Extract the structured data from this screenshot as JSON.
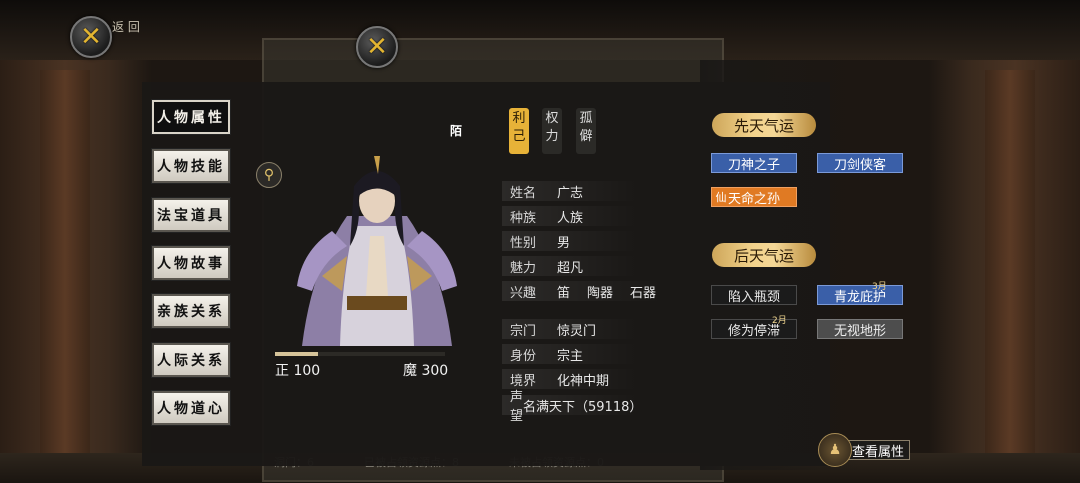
{
  "header": {
    "back_label": "返 回"
  },
  "nav": [
    {
      "label": "人物属性"
    },
    {
      "label": "人物技能"
    },
    {
      "label": "法宝道具"
    },
    {
      "label": "人物故事"
    },
    {
      "label": "亲族关系"
    },
    {
      "label": "人际关系"
    },
    {
      "label": "人物道心"
    }
  ],
  "tabs": [
    {
      "label": "利\n己"
    },
    {
      "label": "权\n力"
    },
    {
      "label": "孤\n僻"
    }
  ],
  "mark": "陌",
  "character": {
    "righteous_label": "正 100",
    "demonic_label": "魔 300",
    "righteous_fraction": 0.25
  },
  "info": [
    {
      "key": "姓名",
      "value": "广志"
    },
    {
      "key": "种族",
      "value": "人族"
    },
    {
      "key": "性别",
      "value": "男"
    },
    {
      "key": "魅力",
      "value": "超凡"
    }
  ],
  "hobby": {
    "key": "兴趣",
    "values": [
      "笛",
      "陶器",
      "石器"
    ]
  },
  "info2": [
    {
      "key": "宗门",
      "value": "惊灵门"
    },
    {
      "key": "身份",
      "value": "宗主"
    },
    {
      "key": "境界",
      "value": "化神中期"
    },
    {
      "key": "声望",
      "value": "名满天下（59118）"
    }
  ],
  "innate": {
    "title": "先天气运",
    "tags": [
      "刀神之子",
      "刀剑侠客",
      "天命之孙"
    ]
  },
  "acquired": {
    "title": "后天气运",
    "tags": [
      "陷入瓶颈",
      "青龙庇护",
      "修为停滞",
      "无视地形"
    ],
    "badges": [
      "3月",
      "2月"
    ]
  },
  "view_button": {
    "label": "查看属性"
  },
  "background": {
    "status": [
      "洞门：6",
      "已被占领资源点：8",
      "未被占领资源点：0"
    ]
  },
  "colors": {
    "accent": "#e7b238",
    "blue_tag": "#3a5fa8",
    "orange_tag": "#e07a23"
  }
}
